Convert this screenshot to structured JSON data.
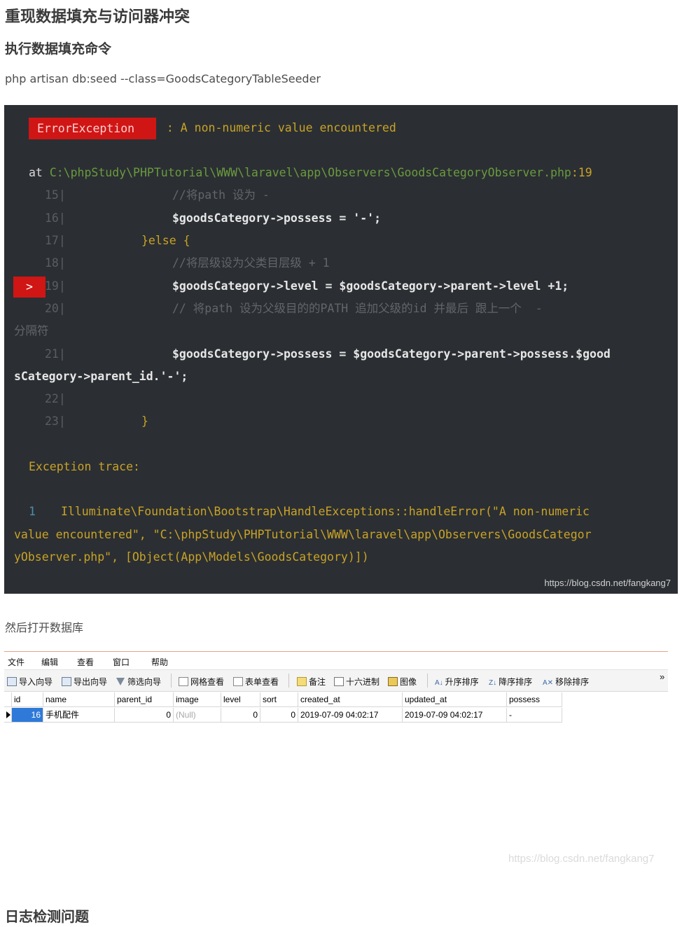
{
  "article": {
    "title": "重现数据填充与访问器冲突",
    "section1": "执行数据填充命令",
    "command": "php artisan db:seed --class=GoodsCategoryTableSeeder",
    "after_text": "然后打开数据库",
    "section2": "日志检测问题"
  },
  "terminal": {
    "error_badge": "ErrorException",
    "error_msg": " : A non-numeric value encountered",
    "at": "at",
    "path": "C:\\phpStudy\\PHPTutorial\\WWW\\laravel\\app\\Observers\\GoodsCategoryObserver.php",
    "line_ref": ":19",
    "arrow": ">",
    "code_lines": [
      {
        "num": "15|",
        "code": "//将path 设为 -"
      },
      {
        "num": "16|",
        "code": "$goodsCategory->possess = '-';"
      },
      {
        "num": "17|",
        "code": "}else {"
      },
      {
        "num": "18|",
        "code": "//将层级设为父类目层级 + 1"
      },
      {
        "num": "19|",
        "code": "$goodsCategory->level = $goodsCategory->parent->level +1;"
      },
      {
        "num": "20|",
        "code": "// 将path 设为父级目的的PATH 追加父级的id 并最后 跟上一个  -"
      },
      {
        "num": "",
        "code": "分隔符"
      },
      {
        "num": "21|",
        "code": "$goodsCategory->possess = $goodsCategory->parent->possess.$good"
      },
      {
        "num": "",
        "code": "sCategory->parent_id.'-';"
      },
      {
        "num": "22|",
        "code": ""
      },
      {
        "num": "23|",
        "code": "}"
      }
    ],
    "trace_title": "Exception trace:",
    "trace_num": "1",
    "trace_lines": [
      "Illuminate\\Foundation\\Bootstrap\\HandleExceptions::handleError(\"A non-numeric",
      "value encountered\", \"C:\\phpStudy\\PHPTutorial\\WWW\\laravel\\app\\Observers\\GoodsCategor",
      "yObserver.php\", [Object(App\\Models\\GoodsCategory)])"
    ],
    "watermark": "https://blog.csdn.net/fangkang7"
  },
  "db": {
    "menu": [
      "文件",
      "编辑",
      "查看",
      "窗口",
      "帮助"
    ],
    "toolbar": [
      "导入向导",
      "导出向导",
      "筛选向导",
      "网格查看",
      "表单查看",
      "备注",
      "十六进制",
      "图像",
      "升序排序",
      "降序排序",
      "移除排序"
    ],
    "overflow": "»",
    "columns": [
      "id",
      "name",
      "parent_id",
      "image",
      "level",
      "sort",
      "created_at",
      "updated_at",
      "possess"
    ],
    "row": {
      "id": "16",
      "name": "手机配件",
      "parent_id": "0",
      "image": "(Null)",
      "level": "0",
      "sort": "0",
      "created_at": "2019-07-09 04:02:17",
      "updated_at": "2019-07-09 04:02:17",
      "possess": "-"
    },
    "watermark": "https://blog.csdn.net/fangkang7"
  }
}
